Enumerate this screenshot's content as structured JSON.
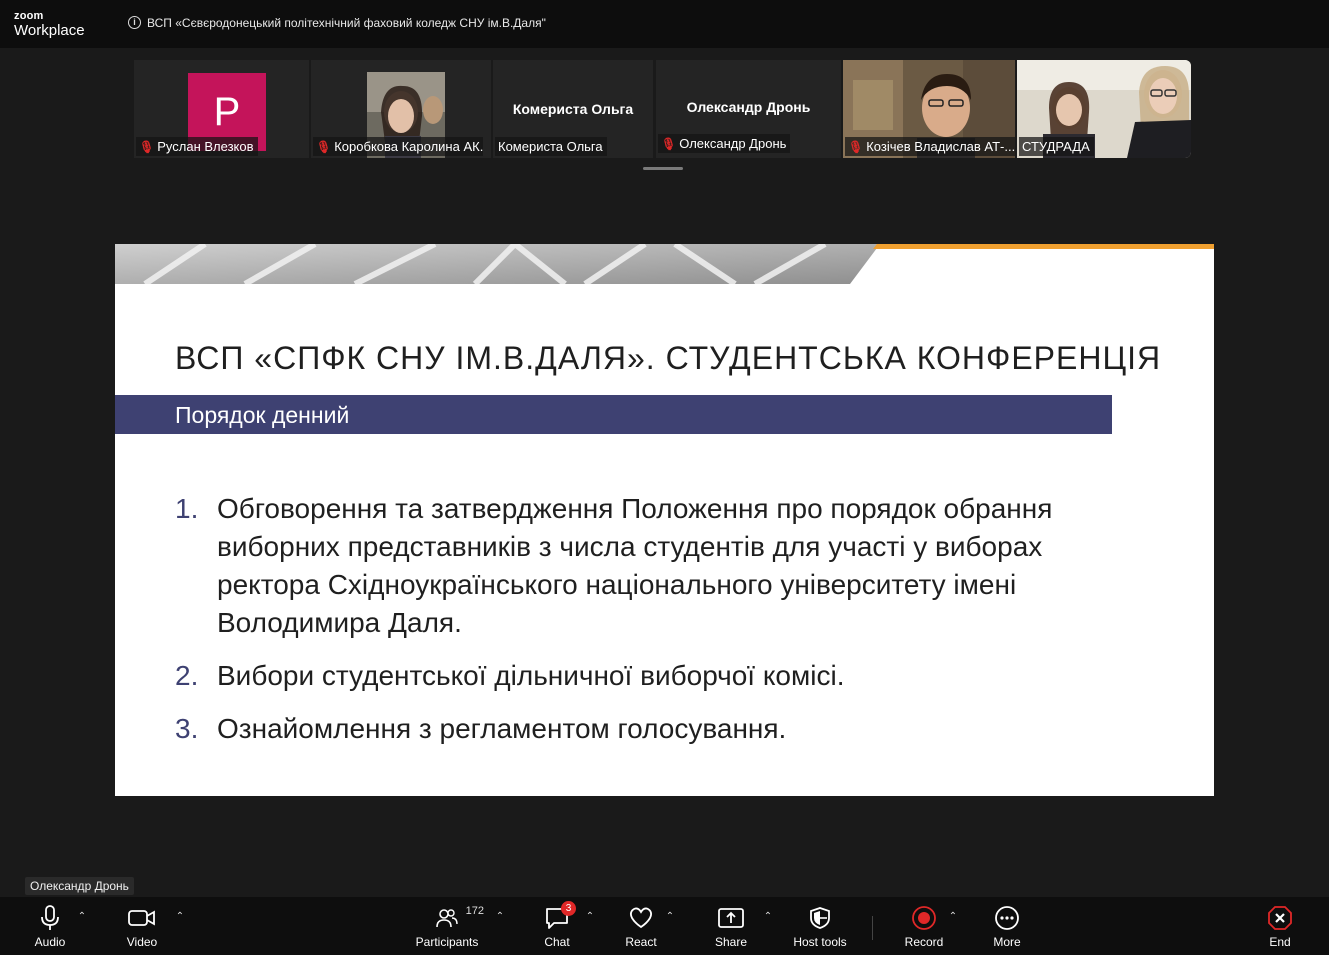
{
  "app": {
    "logo_top": "zoom",
    "logo_bottom": "Workplace",
    "meeting_title": "ВСП «Сєвєродонецький політехнічний фаховий коледж СНУ ім.В.Даля\""
  },
  "gallery": {
    "tiles": [
      {
        "name": "Руслан Влезков",
        "muted": true,
        "avatar_letter": "P"
      },
      {
        "name": "Коробкова Каролина АК...",
        "muted": true
      },
      {
        "name": "Комериста Ольга",
        "muted": false,
        "center_name": "Комериста Ольга"
      },
      {
        "name": "Олександр Дронь",
        "muted": true,
        "center_name": "Олександр Дронь"
      },
      {
        "name": "Козічев Владислав АТ-...",
        "muted": true
      },
      {
        "name": "СТУДРАДА",
        "muted": false
      }
    ]
  },
  "slide": {
    "title": "ВСП «СПФК СНУ ІМ.В.ДАЛЯ». СТУДЕНТСЬКА КОНФЕРЕНЦІЯ",
    "agenda_label": "Порядок денний",
    "items": [
      {
        "num": "1.",
        "text": "Обговорення та затвердження Положення про порядок обрання виборних представників з числа студентів для участі у виборах ректора Східноукраїнського національного університету імені Володимира Даля."
      },
      {
        "num": "2.",
        "text": "Вибори студентської дільничної виборчої комісі."
      },
      {
        "num": "3.",
        "text": "Ознайомлення з регламентом голосування."
      }
    ]
  },
  "speaker_label": "Олександр Дронь",
  "toolbar": {
    "audio": "Audio",
    "video": "Video",
    "participants": "Participants",
    "participants_count": "172",
    "chat": "Chat",
    "chat_badge": "3",
    "react": "React",
    "share": "Share",
    "host_tools": "Host tools",
    "record": "Record",
    "more": "More",
    "end": "End"
  },
  "colors": {
    "agenda_bar": "#3e4172",
    "accent_orange": "#f0a030",
    "record_red": "#e02828",
    "avatar_pink": "#c4145a"
  }
}
